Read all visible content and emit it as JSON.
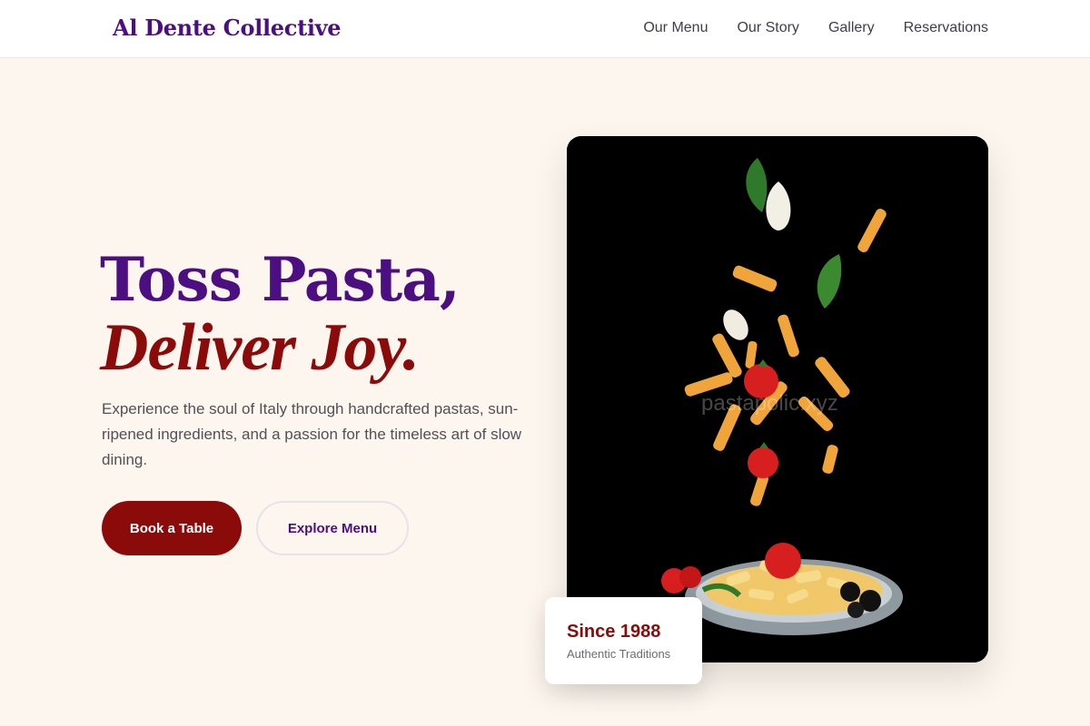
{
  "brand": "Al Dente Collective",
  "nav": [
    "Our Menu",
    "Our Story",
    "Gallery",
    "Reservations"
  ],
  "hero": {
    "title_line1": "Toss Pasta,",
    "title_line2": "Deliver Joy.",
    "description": "Experience the soul of Italy through handcrafted pastas, sun-ripened ingredients, and a passion for the timeless art of slow dining.",
    "primary_button": "Book a Table",
    "secondary_button": "Explore Menu"
  },
  "photo": {
    "watermark": "pastapolic.xyz"
  },
  "badge": {
    "title": "Since 1988",
    "subtitle": "Authentic Traditions"
  },
  "colors": {
    "accent_purple": "#4b0f82",
    "accent_red": "#8b0a0a",
    "background": "#fdf6ee"
  }
}
